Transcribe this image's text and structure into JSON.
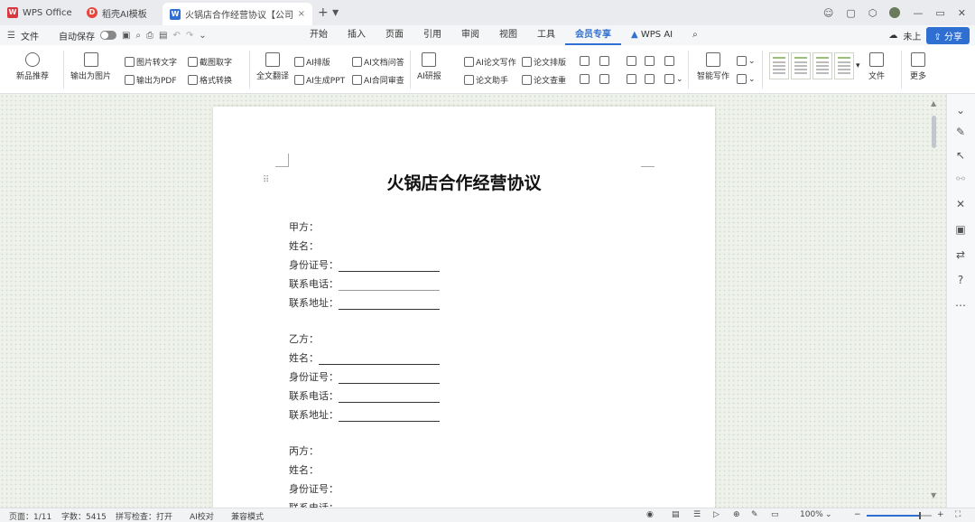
{
  "titlebar": {
    "tabs": [
      {
        "label": "WPS Office",
        "icon": "wps-logo-icon"
      },
      {
        "label": "稻壳AI模板",
        "icon": "docer-icon"
      },
      {
        "label": "火锅店合作经营协议【公司】.d",
        "icon": "word-doc-icon",
        "close": "×"
      }
    ],
    "new_tab": "+ ▾"
  },
  "menubar": {
    "file": "文件",
    "autosave": "自动保存",
    "menus": [
      "开始",
      "插入",
      "页面",
      "引用",
      "审阅",
      "视图",
      "工具",
      "会员专享",
      "WPS AI"
    ],
    "active_menu": "会员专享",
    "share": "分享",
    "user": "未上"
  },
  "ribbon": {
    "new_smart": "新品推荐",
    "to_image": "输出为图片",
    "to_pdf": "输出为PDF",
    "ocr": "图片转文字",
    "ocr2": "截图取字",
    "convert": "格式转换",
    "full_translate": "全文翻译",
    "ai_layout": "AI排版",
    "ai_ppt": "AI生成PPT",
    "ai_doc_read": "AI文档问答",
    "ai_contract": "AI合同审查",
    "ai_report": "AI研报",
    "ai_paper": "AI论文写作",
    "paper_assist": "论文助手",
    "paper_check": "论文查重",
    "paper_format": "论文排版",
    "resume": "智能写作",
    "templates_label": "文件",
    "more": "更多"
  },
  "document": {
    "title": "火锅店合作经营协议",
    "party_a": {
      "label": "甲方：",
      "name": "姓名：",
      "id": "身份证号：",
      "phone": "联系电话：",
      "address": "联系地址："
    },
    "party_b": {
      "label": "乙方：",
      "name": "姓名：",
      "id": "身份证号：",
      "phone": "联系电话：",
      "address": "联系地址："
    },
    "party_c": {
      "label": "丙方：",
      "name": "姓名：",
      "id": "身份证号：",
      "phone": "联系电话："
    }
  },
  "statusbar": {
    "page": "页面：1/11",
    "words": "字数：5415",
    "spell": "拼写检查：打开",
    "ai_check": "AI校对",
    "compat": "兼容模式",
    "zoom": "100%"
  }
}
